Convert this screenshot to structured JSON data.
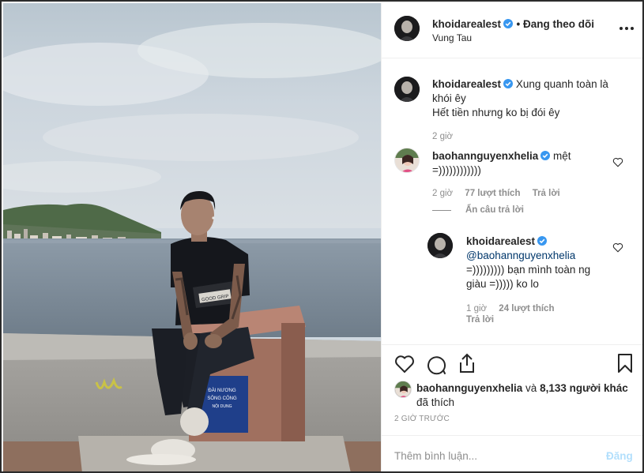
{
  "post": {
    "author": "khoidarealest",
    "follow_status": "• Đang theo dõi",
    "location": "Vung Tau",
    "caption_line1": "Xung quanh toàn là",
    "caption_line2": "khói êy",
    "caption_line3": "Hết tiền nhưng ko bị đói êy",
    "caption_time": "2 giờ"
  },
  "comments": [
    {
      "user": "baohannguyenxhelia",
      "text_line1": "mệt",
      "text_line2": "=))))))))))))",
      "time": "2 giờ",
      "likes": "77 lượt thích",
      "reply": "Trả lời",
      "hide_replies": "Ẩn câu trả lời"
    },
    {
      "user": "khoidarealest",
      "mention": "@baohannguyenxhelia",
      "text_line1": "=))))))))) bạn mình toàn ng",
      "text_line2": "giàu =))))) ko lo",
      "time": "1 giờ",
      "likes": "24 lượt thích",
      "reply": "Trả lời"
    }
  ],
  "likes": {
    "user": "baohannguyenxhelia",
    "connector": "và",
    "others": "8,133 người khác",
    "suffix": "đã thích"
  },
  "timestamp": "2 GIỜ TRƯỚC",
  "add_comment": {
    "placeholder": "Thêm bình luận...",
    "post_button": "Đăng"
  },
  "photo": {
    "shirt_text": "GOOD GRIP",
    "sign_lines": [
      "ĐÀI NƯƠNG",
      "SÔNG CÔNG",
      "NỘI DUNG"
    ]
  },
  "colors": {
    "verified": "#3897f0",
    "link": "#00376b",
    "muted": "#8e8e8e",
    "post_button_disabled": "#b2dffc"
  }
}
